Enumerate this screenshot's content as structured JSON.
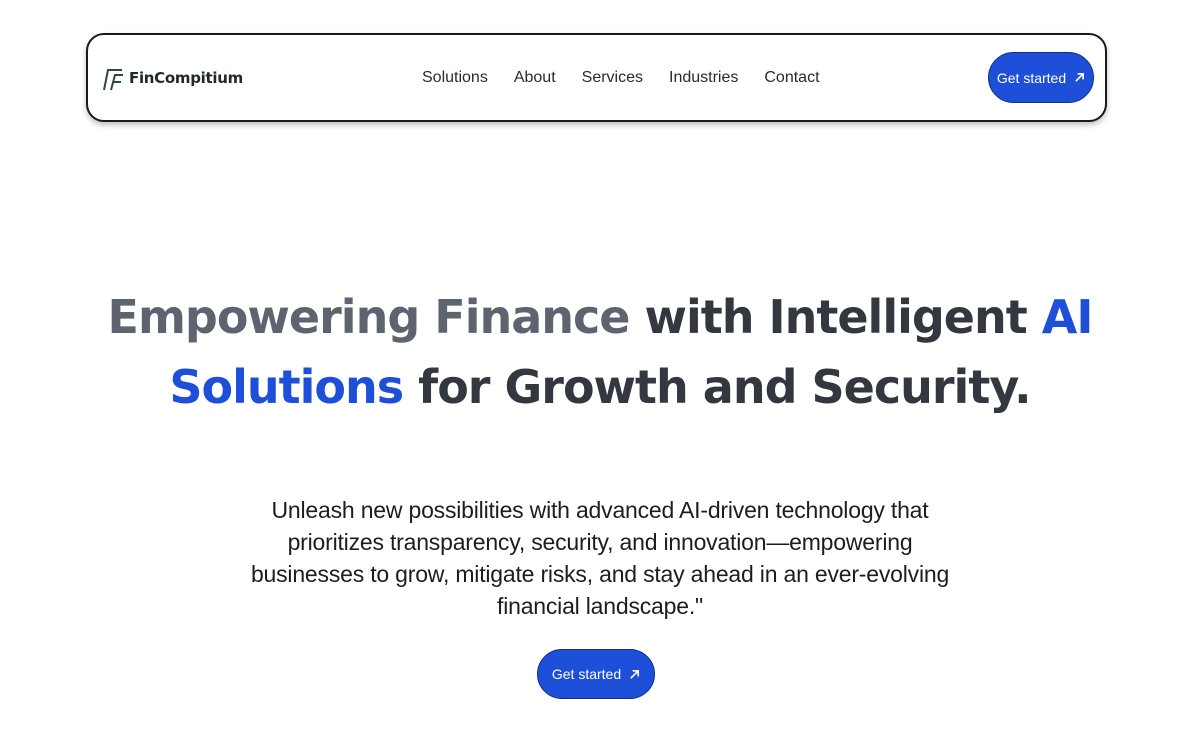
{
  "brand": {
    "name": "FinCompitium",
    "icon": "fincompitium-logo-icon"
  },
  "nav": {
    "links": [
      "Solutions",
      "About",
      "Services",
      "Industries",
      "Contact"
    ],
    "cta_label": "Get started"
  },
  "hero": {
    "title_part1": "Empowering Finance",
    "title_part2": " with Intelligent ",
    "title_part3": "AI Solutions",
    "title_part4": " for Growth and Security.",
    "subtitle": "Unleash new possibilities with advanced AI-driven technology that prioritizes transparency, security, and innovation—empowering businesses to grow, mitigate risks, and stay ahead in an ever-evolving financial landscape.\"",
    "cta_label": "Get started"
  },
  "colors": {
    "accent": "#1e4fd8",
    "heading": "#333740",
    "heading_muted": "#5d6470"
  },
  "icons": {
    "cta_arrow": "arrow-up-right-icon"
  }
}
